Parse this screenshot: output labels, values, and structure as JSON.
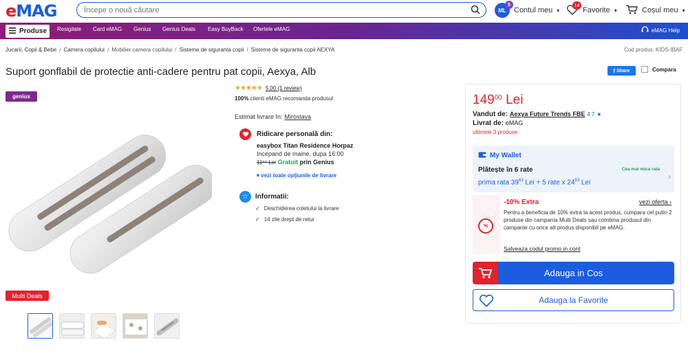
{
  "header": {
    "logo_prefix": "e",
    "logo_rest": "MAG",
    "search_placeholder": "Începe o nouă căutare",
    "account_initials": "ML",
    "account_badge": "5",
    "account_label": "Contul meu",
    "favorites_label": "Favorite",
    "favorites_count": "14",
    "cart_label": "Coșul meu"
  },
  "nav": {
    "products_label": "Produse",
    "items": [
      "Resigilate",
      "Card eMAG",
      "Genius",
      "Genius Deals",
      "Easy BuyBack",
      "Ofertele eMAG"
    ],
    "help_label": "eMAG Help"
  },
  "breadcrumb": {
    "items": [
      "Jucarii, Copii & Bebe",
      "Camera copilului",
      "Mobilier camera copilului",
      "Sisteme de siguranta copii",
      "Sisteme de siguranta copii AEXYA"
    ],
    "product_code": "Cod produs: KIDS-IBAF"
  },
  "product": {
    "title": "Suport gonflabil de protectie anti-cadere pentru pat copii, Aexya, Alb",
    "share_label": "Share",
    "compare_label": "Compara",
    "genius_badge": "genius",
    "multi_deals_badge": "Multi Deals",
    "rating_stars": 5,
    "rating_text": "5.00 (1 review)",
    "recommend_pct": "100%",
    "recommend_text": "clienti eMAG recomanda produsul"
  },
  "delivery": {
    "estimate_label": "Estimat livrare în:",
    "location": "Miroslava",
    "pickup_title": "Ridicare personală din:",
    "pickup_place": "easybox Titan Residence Horpaz",
    "pickup_time": "Incepand de maine, dupa 16:00",
    "old_price": "11⁹⁹ Lei",
    "free_label": "Gratuit",
    "genius_text": "prin Genius",
    "all_options": "vezi toate opțiunile de livrare"
  },
  "info": {
    "title": "Informatii:",
    "items": [
      "Deschiderea coletului la livrare",
      "14 zile drept de retur"
    ]
  },
  "buy": {
    "price_int": "149",
    "price_dec": "00",
    "currency": "Lei",
    "sold_by_label": "Vandut de:",
    "seller": "Aexya Future Trends FBE",
    "seller_rating": "4.7",
    "delivered_by_label": "Livrat de:",
    "delivered_by": "eMAG",
    "stock": "ultimele 3 produse"
  },
  "wallet": {
    "title": "My Wallet",
    "installments": "Plătește în 6 rate",
    "tag": "Cea mai mica rata",
    "first_label": "prima rata",
    "first_int": "39",
    "first_dec": "83",
    "rest_text": "Lei + 5 rate x",
    "rest_int": "24",
    "rest_dec": "83",
    "currency": "Lei"
  },
  "promo": {
    "title": "-10% Extra",
    "see_offer": "vezi oferta",
    "icon_text": "%",
    "text": "Pentru a beneficia de 10% extra la acest produs, cumpara cel putin 2 produse din campania Multi Deals sau combina produsul din campanie cu orice alt produs disponibil pe eMAG.",
    "save_code": "Salveaza codul promo in cont"
  },
  "actions": {
    "add_to_cart": "Adauga in Cos",
    "add_to_favorites": "Adauga la Favorite"
  },
  "colors": {
    "brand_blue": "#1a5ddf",
    "brand_red": "#e4212c",
    "genius_purple": "#7a2a8f"
  }
}
